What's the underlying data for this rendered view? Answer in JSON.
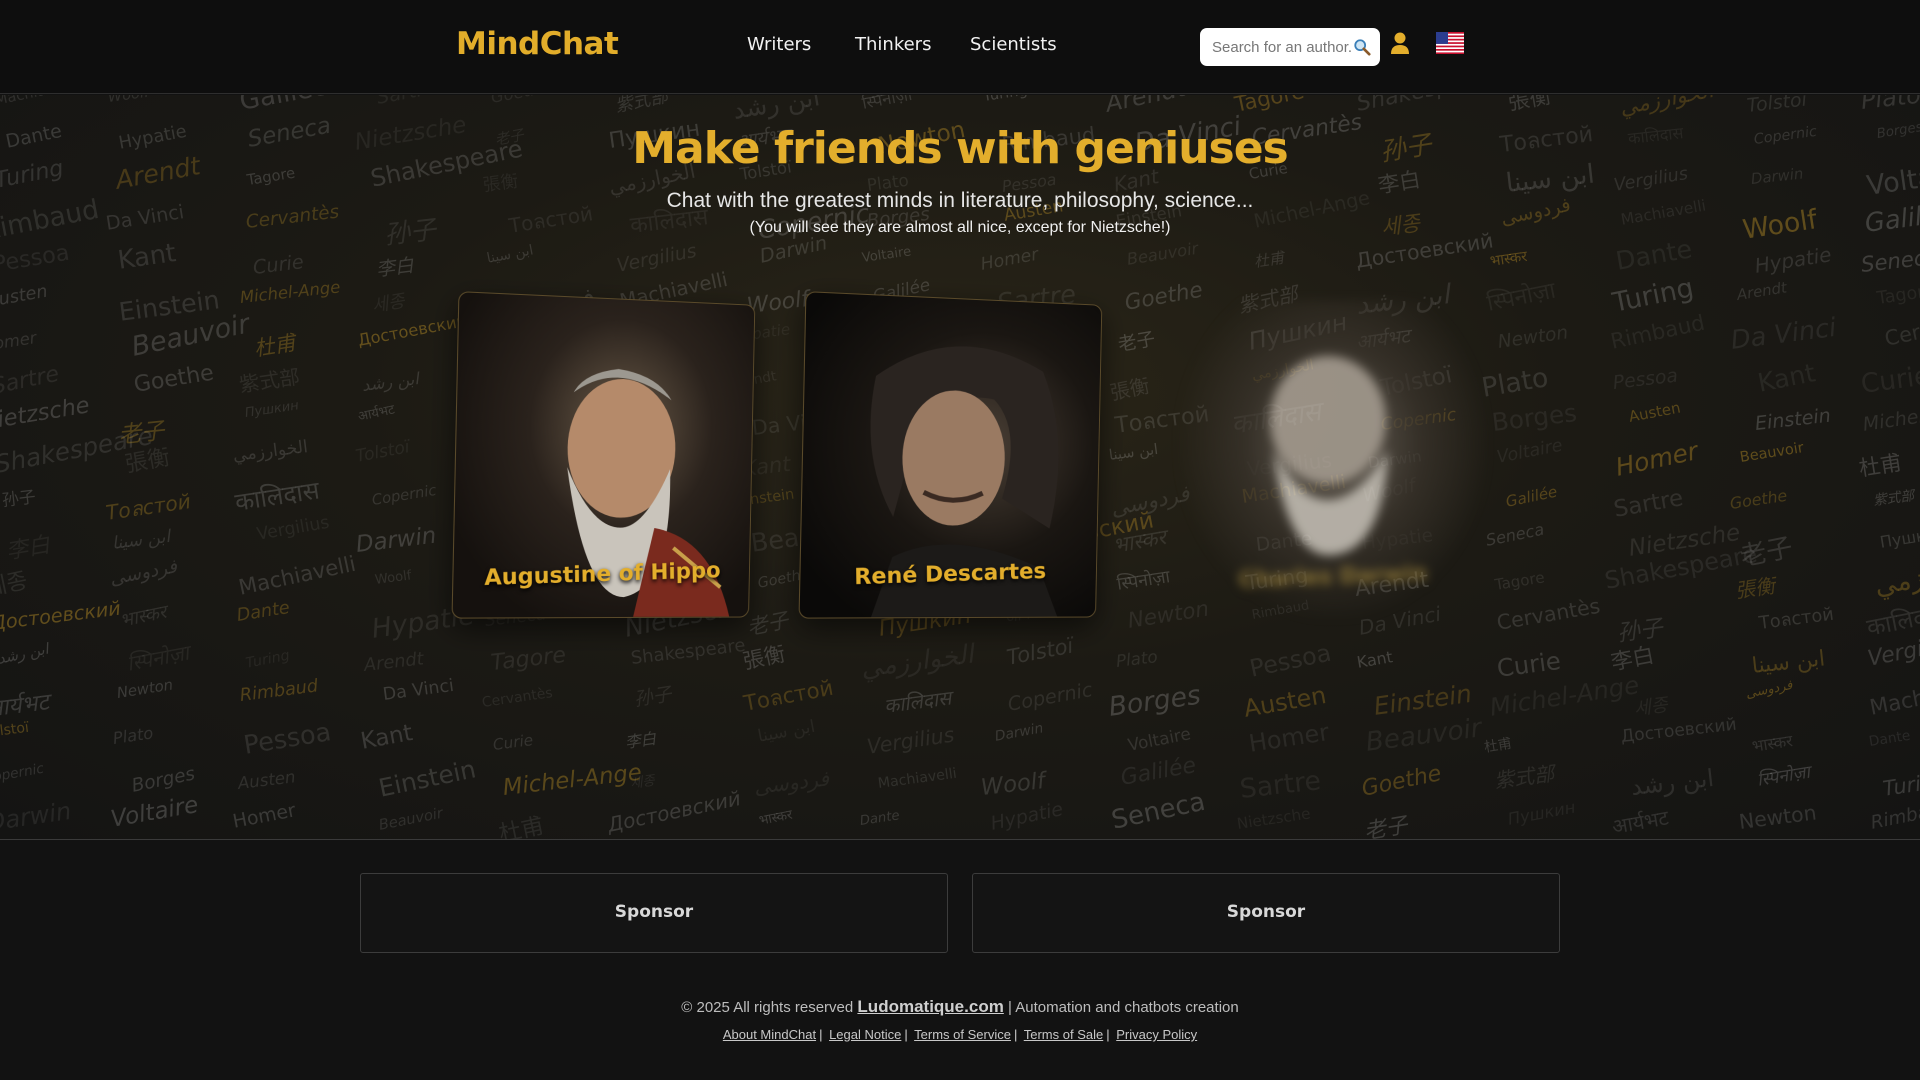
{
  "header": {
    "logo": "MindChat",
    "nav": [
      "Writers",
      "Thinkers",
      "Scientists"
    ],
    "search_placeholder": "Search for an author...",
    "icons": [
      "search-icon",
      "user-icon",
      "us-flag-icon"
    ]
  },
  "hero": {
    "title": "Make friends with geniuses",
    "subtitle": "Chat with the greatest minds in literature, philosophy, science...",
    "note": "(You will see they are almost all nice, except for Nietzsche!)"
  },
  "cards": [
    {
      "name": "Augustine of Hippo"
    },
    {
      "name": "René Descartes"
    },
    {
      "name": "Charles Darwin"
    }
  ],
  "background_words": [
    "Machiavelli",
    "Copernic",
    "Newton",
    "Dante",
    "Darwin",
    "Plato",
    "Turing",
    "Woolf",
    "Borges",
    "Rimbaud",
    "Hypatie",
    "Voltaire",
    "Pessoa",
    "Arendt",
    "Galilée",
    "Austen",
    "Da Vinci",
    "Seneca",
    "Homer",
    "Kant",
    "Tagore",
    "Sartre",
    "Einstein",
    "Cervantès",
    "Nietzsche",
    "Beauvoir",
    "Curie",
    "Shakespeare",
    "Goethe",
    "Michel-Ange",
    "孙子",
    "老子",
    "杜甫",
    "李白",
    "張衡",
    "紫式部",
    "세종",
    "Тоลстой",
    "Пушкин",
    "Достоевский",
    "ابن سينا",
    "الخوارزمي",
    "ابن رشد",
    "فردوسی",
    "कालिदास",
    "आर्यभट",
    "भास्कर",
    "Vergilius",
    "Tolstoï",
    "स्पिनोज़ा"
  ],
  "sponsors": [
    "Sponsor",
    "Sponsor"
  ],
  "footer": {
    "copyright": "© 2025 All rights reserved",
    "site_link": "Ludomatique.com",
    "tagline": "| Automation and chatbots creation",
    "links": [
      "About MindChat",
      "Legal Notice",
      "Terms of Service",
      "Terms of Sale",
      "Privacy Policy"
    ]
  },
  "colors": {
    "accent": "#e3ae2c",
    "background": "#121212"
  }
}
